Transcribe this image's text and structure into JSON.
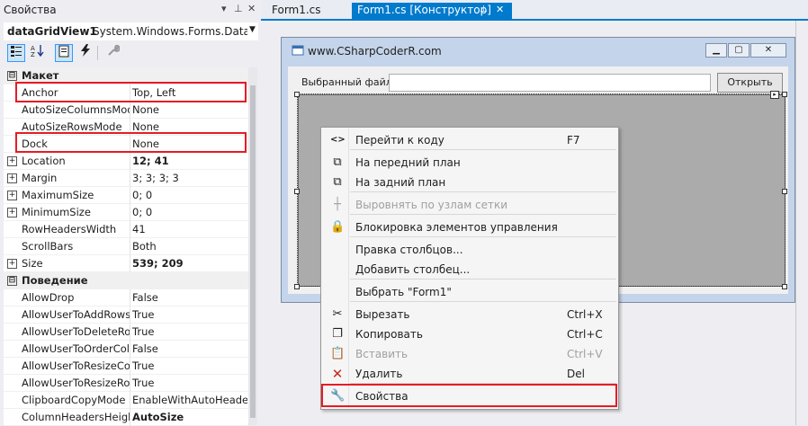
{
  "properties_pane": {
    "title": "Свойства",
    "controls": {
      "dropdown": "▾",
      "pin": "⊥",
      "close": "✕"
    },
    "object_name": "dataGridView1",
    "object_type": "System.Windows.Forms.DataGrid",
    "rows": [
      {
        "kind": "cat",
        "expander": "⊟",
        "name": "Макет",
        "value": ""
      },
      {
        "kind": "prop",
        "expander": "",
        "name": "Anchor",
        "value": "Top, Left",
        "bold": false
      },
      {
        "kind": "prop",
        "expander": "",
        "name": "AutoSizeColumnsMod",
        "value": "None",
        "bold": false
      },
      {
        "kind": "prop",
        "expander": "",
        "name": "AutoSizeRowsMode",
        "value": "None",
        "bold": false
      },
      {
        "kind": "prop",
        "expander": "",
        "name": "Dock",
        "value": "None",
        "bold": false
      },
      {
        "kind": "prop",
        "expander": "+",
        "name": "Location",
        "value": "12; 41",
        "bold": true
      },
      {
        "kind": "prop",
        "expander": "+",
        "name": "Margin",
        "value": "3; 3; 3; 3",
        "bold": false
      },
      {
        "kind": "prop",
        "expander": "+",
        "name": "MaximumSize",
        "value": "0; 0",
        "bold": false
      },
      {
        "kind": "prop",
        "expander": "+",
        "name": "MinimumSize",
        "value": "0; 0",
        "bold": false
      },
      {
        "kind": "prop",
        "expander": "",
        "name": "RowHeadersWidth",
        "value": "41",
        "bold": false
      },
      {
        "kind": "prop",
        "expander": "",
        "name": "ScrollBars",
        "value": "Both",
        "bold": false
      },
      {
        "kind": "prop",
        "expander": "+",
        "name": "Size",
        "value": "539; 209",
        "bold": true
      },
      {
        "kind": "cat",
        "expander": "⊟",
        "name": "Поведение",
        "value": ""
      },
      {
        "kind": "prop",
        "expander": "",
        "name": "AllowDrop",
        "value": "False",
        "bold": false
      },
      {
        "kind": "prop",
        "expander": "",
        "name": "AllowUserToAddRows",
        "value": "True",
        "bold": false
      },
      {
        "kind": "prop",
        "expander": "",
        "name": "AllowUserToDeleteRov",
        "value": "True",
        "bold": false
      },
      {
        "kind": "prop",
        "expander": "",
        "name": "AllowUserToOrderColu",
        "value": "False",
        "bold": false
      },
      {
        "kind": "prop",
        "expander": "",
        "name": "AllowUserToResizeCol",
        "value": "True",
        "bold": false
      },
      {
        "kind": "prop",
        "expander": "",
        "name": "AllowUserToResizeRov",
        "value": "True",
        "bold": false
      },
      {
        "kind": "prop",
        "expander": "",
        "name": "ClipboardCopyMode",
        "value": "EnableWithAutoHeaderT",
        "bold": false
      },
      {
        "kind": "prop",
        "expander": "",
        "name": "ColumnHeadersHeigh",
        "value": "AutoSize",
        "bold": true
      }
    ]
  },
  "tabs": [
    {
      "label": "Form1.cs",
      "active": false
    },
    {
      "label": "Form1.cs [Конструктор]",
      "active": true,
      "pin": "⊥",
      "close": "✕"
    }
  ],
  "form": {
    "title": "www.CSharpCoderR.com",
    "label": "Выбранный файл",
    "textbox_value": "",
    "button": "Открыть"
  },
  "context_menu": {
    "items": [
      {
        "icon": "code-icon",
        "glyph": "<>",
        "label": "Перейти к коду",
        "shortcut": "F7",
        "disabled": false
      },
      {
        "icon": "bring-to-front-icon",
        "glyph": "⧉",
        "label": "На передний план",
        "shortcut": "",
        "disabled": false
      },
      {
        "icon": "send-to-back-icon",
        "glyph": "⧉",
        "label": "На задний план",
        "shortcut": "",
        "disabled": false
      },
      {
        "icon": "align-to-grid-icon",
        "glyph": "┼",
        "label": "Выровнять по узлам сетки",
        "shortcut": "",
        "disabled": true
      },
      {
        "icon": "lock-icon",
        "glyph": "🔒",
        "label": "Блокировка элементов управления",
        "shortcut": "",
        "disabled": false
      },
      {
        "icon": "",
        "glyph": "",
        "label": "Правка столбцов...",
        "shortcut": "",
        "disabled": false
      },
      {
        "icon": "",
        "glyph": "",
        "label": "Добавить столбец...",
        "shortcut": "",
        "disabled": false
      },
      {
        "icon": "",
        "glyph": "",
        "label": "Выбрать \"Form1\"",
        "shortcut": "",
        "disabled": false
      },
      {
        "icon": "cut-icon",
        "glyph": "✂",
        "label": "Вырезать",
        "shortcut": "Ctrl+X",
        "disabled": false
      },
      {
        "icon": "copy-icon",
        "glyph": "❐",
        "label": "Копировать",
        "shortcut": "Ctrl+C",
        "disabled": false
      },
      {
        "icon": "paste-icon",
        "glyph": "📋",
        "label": "Вставить",
        "shortcut": "Ctrl+V",
        "disabled": true
      },
      {
        "icon": "delete-icon",
        "glyph": "✕",
        "label": "Удалить",
        "shortcut": "Del",
        "disabled": false
      },
      {
        "icon": "wrench-icon",
        "glyph": "🔧",
        "label": "Свойства",
        "shortcut": "",
        "disabled": false
      }
    ]
  },
  "colors": {
    "accent": "#007acc",
    "highlight_box": "#e51c24",
    "delete_icon": "#c42b1c"
  }
}
